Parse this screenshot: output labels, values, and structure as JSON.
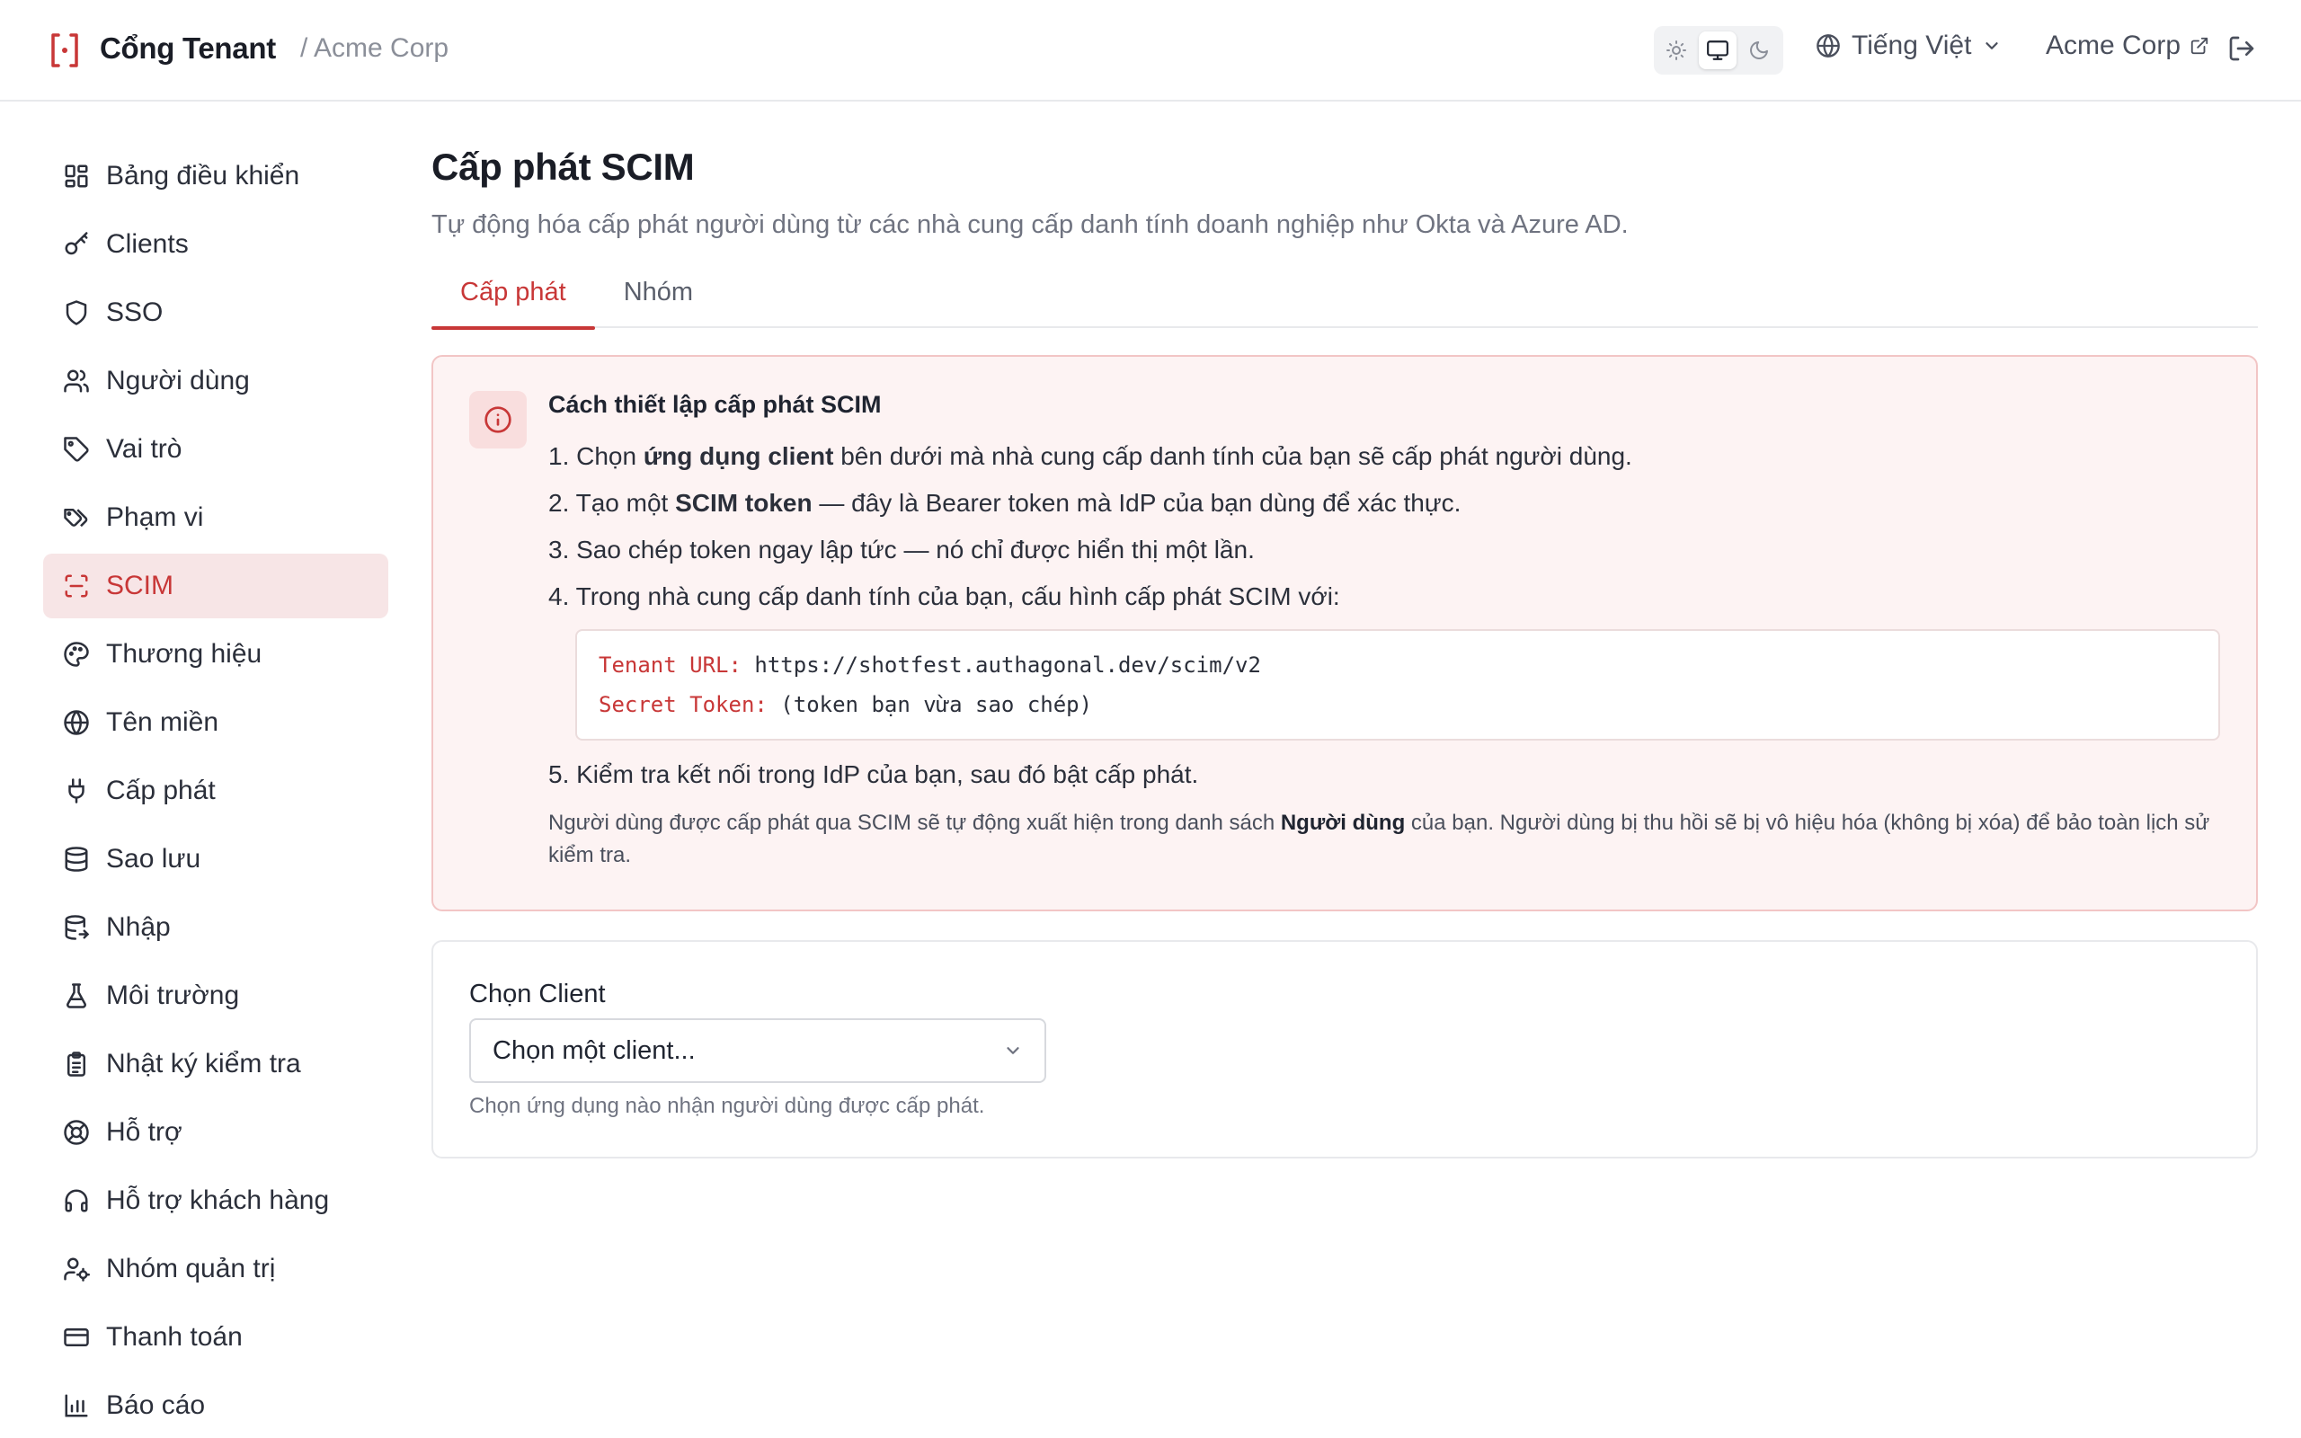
{
  "header": {
    "title": "Cổng Tenant",
    "tenant": "/ Acme Corp",
    "language": "Tiếng Việt",
    "org_link": "Acme Corp"
  },
  "sidebar": {
    "items": [
      {
        "label": "Bảng điều khiển",
        "icon": "dashboard-icon"
      },
      {
        "label": "Clients",
        "icon": "key-icon"
      },
      {
        "label": "SSO",
        "icon": "shield-icon"
      },
      {
        "label": "Người dùng",
        "icon": "users-icon"
      },
      {
        "label": "Vai trò",
        "icon": "tag-icon"
      },
      {
        "label": "Phạm vi",
        "icon": "tags-icon"
      },
      {
        "label": "SCIM",
        "icon": "scan-icon"
      },
      {
        "label": "Thương hiệu",
        "icon": "palette-icon"
      },
      {
        "label": "Tên miền",
        "icon": "globe-icon"
      },
      {
        "label": "Cấp phát",
        "icon": "plug-icon"
      },
      {
        "label": "Sao lưu",
        "icon": "database-icon"
      },
      {
        "label": "Nhập",
        "icon": "database-import-icon"
      },
      {
        "label": "Môi trường",
        "icon": "flask-icon"
      },
      {
        "label": "Nhật ký kiểm tra",
        "icon": "clipboard-icon"
      },
      {
        "label": "Hỗ trợ",
        "icon": "lifebuoy-icon"
      },
      {
        "label": "Hỗ trợ khách hàng",
        "icon": "headset-icon"
      },
      {
        "label": "Nhóm quản trị",
        "icon": "user-cog-icon"
      },
      {
        "label": "Thanh toán",
        "icon": "credit-card-icon"
      },
      {
        "label": "Báo cáo",
        "icon": "bar-chart-icon"
      }
    ],
    "active_index": 6
  },
  "main": {
    "title": "Cấp phát SCIM",
    "subtitle": "Tự động hóa cấp phát người dùng từ các nhà cung cấp danh tính doanh nghiệp như Okta và Azure AD.",
    "tabs": [
      {
        "label": "Cấp phát",
        "active": true
      },
      {
        "label": "Nhóm",
        "active": false
      }
    ],
    "info": {
      "title": "Cách thiết lập cấp phát SCIM",
      "step1_pre": "1. Chọn ",
      "step1_bold": "ứng dụng client",
      "step1_post": " bên dưới mà nhà cung cấp danh tính của bạn sẽ cấp phát người dùng.",
      "step2_pre": "2. Tạo một ",
      "step2_bold": "SCIM token",
      "step2_post": " — đây là Bearer token mà IdP của bạn dùng để xác thực.",
      "step3": "3. Sao chép token ngay lập tức — nó chỉ được hiển thị một lần.",
      "step4": "4. Trong nhà cung cấp danh tính của bạn, cấu hình cấp phát SCIM với:",
      "code_url_key": "Tenant URL:",
      "code_url_val": "https://shotfest.authagonal.dev/scim/v2",
      "code_token_key": "Secret Token:",
      "code_token_val": "(token bạn vừa sao chép)",
      "step5": "5. Kiểm tra kết nối trong IdP của bạn, sau đó bật cấp phát.",
      "note_pre": "Người dùng được cấp phát qua SCIM sẽ tự động xuất hiện trong danh sách ",
      "note_bold": "Người dùng",
      "note_post": " của bạn. Người dùng bị thu hồi sẽ bị vô hiệu hóa (không bị xóa) để bảo toàn lịch sử kiểm tra."
    },
    "client_select": {
      "label": "Chọn Client",
      "value": "Chọn một client...",
      "help": "Chọn ứng dụng nào nhận người dùng được cấp phát."
    }
  },
  "colors": {
    "accent": "#c83737",
    "active_bg": "#f7e5e6",
    "info_bg": "#fdf3f3",
    "info_border": "#f2c5c5"
  }
}
